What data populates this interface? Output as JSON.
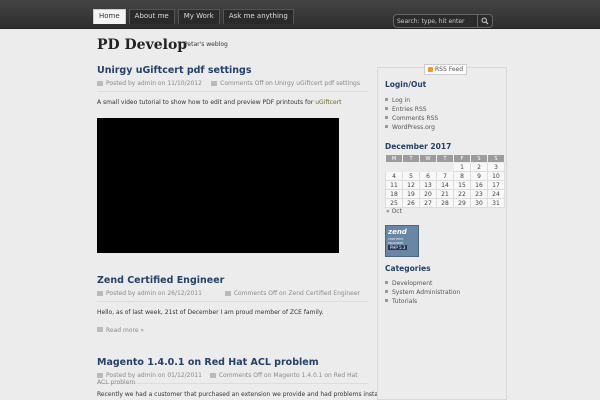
{
  "nav": {
    "tabs": [
      {
        "label": "Home"
      },
      {
        "label": "About me"
      },
      {
        "label": "My Work"
      },
      {
        "label": "Ask me anything"
      }
    ]
  },
  "search": {
    "placeholder": "Search: type, hit enter"
  },
  "site": {
    "title": "PD Develop",
    "tagline": "Petar's weblog"
  },
  "posts": [
    {
      "title": "Unirgy uGiftcert pdf settings",
      "meta_left": "Posted by admin on 11/10/2012",
      "meta_right": "Comments Off on Unirgy uGiftcert pdf settings",
      "excerpt": "A small video tutorial to show how to edit and preview PDF printouts for ",
      "excerpt_link": "uGiftcert"
    },
    {
      "title": "Zend Certified Engineer",
      "meta_left": "Posted by admin on 26/12/2011",
      "meta_right": "Comments Off on Zend Certified Engineer",
      "excerpt": "Hello, as of last week, 21st of December I am proud member of ZCE family.",
      "read_more": "Read more »"
    },
    {
      "title": "Magento 1.4.0.1 on Red Hat ACL problem",
      "meta_left": "Posted by admin on 01/12/2011",
      "meta_right": "Comments Off on Magento 1.4.0.1 on Red Hat ACL problem",
      "excerpt": "Recently we had a customer that purchased an extension we provide and had problems installing"
    }
  ],
  "sidebar": {
    "rss": "RSS Feed",
    "login_title": "Login/Out",
    "login_items": [
      "Log in",
      "Entries RSS",
      "Comments RSS",
      "WordPress.org"
    ],
    "calendar_title": "December 2017",
    "calendar_days": [
      "M",
      "T",
      "W",
      "T",
      "F",
      "S",
      "S"
    ],
    "calendar_weeks": [
      [
        "",
        "",
        "",
        "",
        "1",
        "2",
        "3"
      ],
      [
        "4",
        "5",
        "6",
        "7",
        "8",
        "9",
        "10"
      ],
      [
        "11",
        "12",
        "13",
        "14",
        "15",
        "16",
        "17"
      ],
      [
        "18",
        "19",
        "20",
        "21",
        "22",
        "23",
        "24"
      ],
      [
        "25",
        "26",
        "27",
        "28",
        "29",
        "30",
        "31"
      ]
    ],
    "calendar_prev": "« Oct",
    "badge": {
      "brand": "zend",
      "line1": "CERTIFIED ENGINEER",
      "line2": "PHP 5.3"
    },
    "categories_title": "Categories",
    "categories": [
      "Development",
      "System Administration",
      "Tutorials"
    ]
  }
}
